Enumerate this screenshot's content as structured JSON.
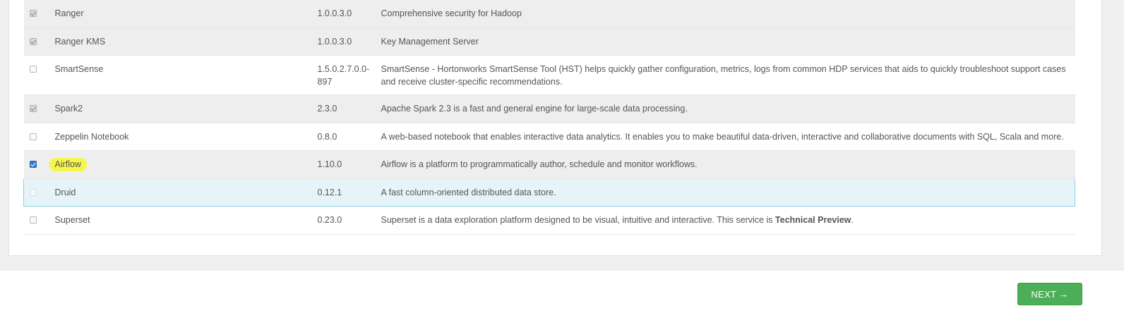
{
  "services": [
    {
      "name": "Ranger",
      "version": "1.0.0.3.0",
      "description": "Comprehensive security for Hadoop",
      "state": "checked-disabled",
      "row": "selected"
    },
    {
      "name": "Ranger KMS",
      "version": "1.0.0.3.0",
      "description": "Key Management Server",
      "state": "checked-disabled",
      "row": "selected"
    },
    {
      "name": "SmartSense",
      "version": "1.5.0.2.7.0.0-897",
      "description": "SmartSense - Hortonworks SmartSense Tool (HST) helps quickly gather configuration, metrics, logs from common HDP services that aids to quickly troubleshoot support cases and receive cluster-specific recommendations.",
      "state": "unchecked",
      "row": "unselected"
    },
    {
      "name": "Spark2",
      "version": "2.3.0",
      "description": "Apache Spark 2.3 is a fast and general engine for large-scale data processing.",
      "state": "checked-disabled",
      "row": "selected"
    },
    {
      "name": "Zeppelin Notebook",
      "version": "0.8.0",
      "description": "A web-based notebook that enables interactive data analytics. It enables you to make beautiful data-driven, interactive and collaborative documents with SQL, Scala and more.",
      "state": "unchecked",
      "row": "unselected"
    },
    {
      "name": "Airflow",
      "version": "1.10.0",
      "description": "Airflow is a platform to programmatically author, schedule and monitor workflows.",
      "state": "checked-active",
      "row": "selected",
      "highlight": true
    },
    {
      "name": "Druid",
      "version": "0.12.1",
      "description": "A fast column-oriented distributed data store.",
      "state": "unchecked-faded",
      "row": "hover"
    },
    {
      "name": "Superset",
      "version": "0.23.0",
      "description": "Superset is a data exploration platform designed to be visual, intuitive and interactive. This service is ",
      "description_strong": "Technical Preview",
      "description_tail": ".",
      "state": "unchecked",
      "row": "unselected"
    }
  ],
  "footer": {
    "next_label": "NEXT",
    "next_arrow": "→",
    "next_color": "#4cae57"
  },
  "colors": {
    "selected_row": "#eeeeee",
    "hover_row": "#e6f4fa",
    "highlight": "#f6f54a"
  }
}
